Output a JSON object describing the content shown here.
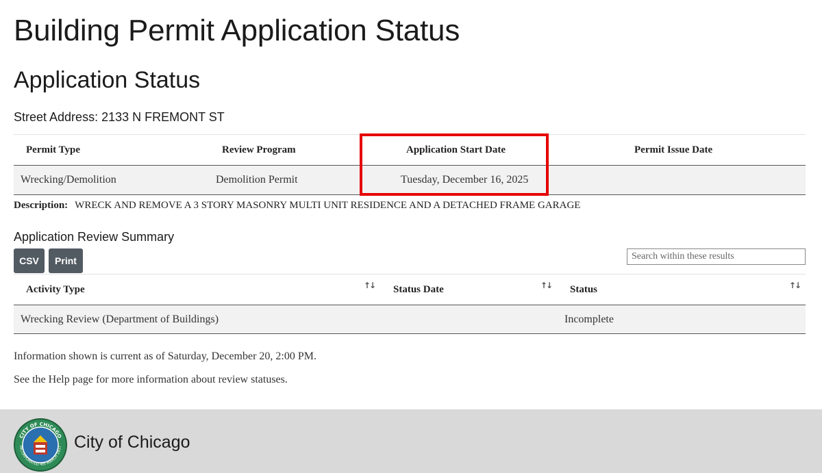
{
  "page": {
    "title": "Building Permit Application Status",
    "section_title": "Application Status",
    "address_label": "Street Address:",
    "address_value": "2133 N FREMONT ST"
  },
  "permit_table": {
    "headers": {
      "permit_type": "Permit Type",
      "review_program": "Review Program",
      "start_date": "Application Start Date",
      "issue_date": "Permit Issue Date"
    },
    "row": {
      "permit_type": "Wrecking/Demolition",
      "review_program": "Demolition Permit",
      "start_date": "Tuesday, December 16, 2025",
      "issue_date": ""
    }
  },
  "description": {
    "label": "Description:",
    "text": "WRECK AND REMOVE A 3 STORY MASONRY MULTI UNIT RESIDENCE AND A DETACHED FRAME GARAGE"
  },
  "review_summary": {
    "title": "Application Review Summary",
    "csv_label": "CSV",
    "print_label": "Print",
    "search_placeholder": "Search within these results",
    "headers": {
      "activity_type": "Activity Type",
      "status_date": "Status Date",
      "status": "Status"
    },
    "rows": [
      {
        "activity_type": "Wrecking Review (Department of Buildings)",
        "status_date": "",
        "status": "Incomplete"
      }
    ]
  },
  "info": {
    "current_as_of": "Information shown is current as of Saturday, December 20, 2:00 PM.",
    "help_text": "See the Help page for more information about review statuses."
  },
  "footer": {
    "city_name": "City of Chicago",
    "seal_text_top": "CITY OF CHICAGO",
    "seal_text_bottom": "INCORPORATED 4th MARCH 1837"
  },
  "colors": {
    "highlight": "#e60000",
    "button_bg": "#525a62",
    "footer_bg": "#d9d9d9",
    "row_bg": "#f2f2f2"
  },
  "icons": {
    "sort": "sort-arrows-icon",
    "seal": "city-seal-icon"
  }
}
